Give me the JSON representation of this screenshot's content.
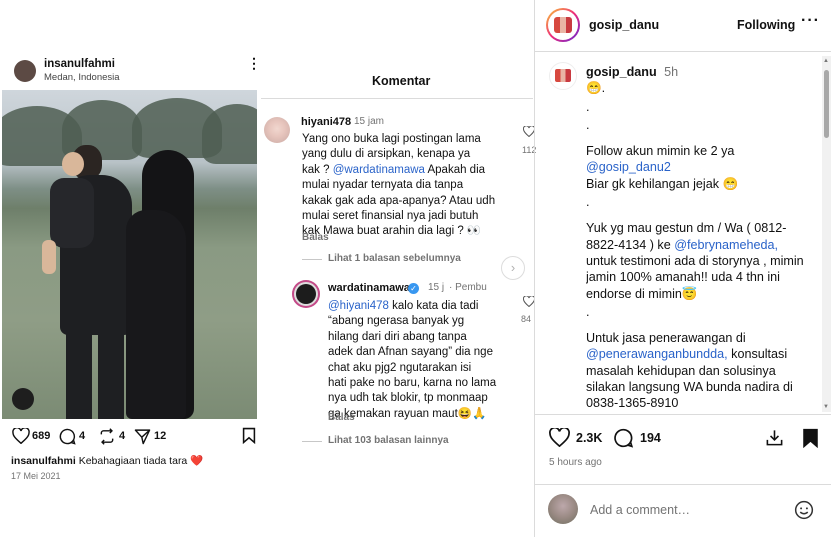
{
  "post": {
    "username": "insanulfahmi",
    "location": "Medan, Indonesia",
    "likes": "689",
    "comments": "4",
    "reposts": "4",
    "shares": "12",
    "caption_user": "insanulfahmi",
    "caption_text": "Kebahagiaan tiada tara ❤️",
    "date": "17 Mei 2021"
  },
  "comments_panel": {
    "title": "Komentar",
    "c1": {
      "user": "hiyani478",
      "time": "15 jam",
      "lines": [
        "Yang ono buka lagi postingan lama",
        "yang dulu di arsipkan, kenapa ya",
        "kak ?",
        "mulai nyadar ternyata dia tanpa",
        "kakak gak ada apa-apanya? Atau udh",
        "mulai seret finansial nya jadi butuh",
        "kak Mawa buat arahin dia lagi ? 👀"
      ],
      "mention": "@wardatinamawa",
      "line3_rest": "Apakah dia",
      "reply_label": "Balas",
      "like_count": "112",
      "view_prev": "Lihat 1 balasan sebelumnya"
    },
    "c2": {
      "user": "wardatinamawa",
      "time": "15 j",
      "badge": "Pembu",
      "mention": "@hiyani478",
      "line1_rest": "kalo kata dia tadi",
      "lines": [
        "“abang ngerasa banyak yg",
        "hilang dari diri abang tanpa",
        "adek dan Afnan sayang” dia nge",
        "chat aku pjg2 ngutarakan isi",
        "hati pake no baru, karna no lama",
        "nya udh tak blokir, tp monmaap",
        "ga kemakan rayuan maut😆🙏"
      ],
      "reply_label": "Balas",
      "like_count": "84"
    },
    "view_more": "Lihat 103 balasan lainnya"
  },
  "right": {
    "username": "gosip_danu",
    "follow_label": "Following",
    "caption_user": "gosip_danu",
    "caption_time": "5h",
    "caption_emoji": "😁.",
    "dot1": ".",
    "dot2": ".",
    "follow_line": "Follow akun mimin ke 2 ya",
    "mention1": "@gosip_danu2",
    "biar": "Biar gk kehilangan jejak 😁",
    "dot3": ".",
    "yuk1": "Yuk yg mau gestun dm / Wa ( 0812-",
    "yuk2_pre": "8822-4134 ) ke",
    "mention2": "@febrynameheda,",
    "yuk3": "untuk testimoni ada di storynya , mimin",
    "yuk4": "jamin 100% amanah!! uda 4 thn ini",
    "yuk5": "endorse di mimin😇",
    "dot4": ".",
    "jasa1": "Untuk jasa penerawangan di",
    "mention3": "@penerawanganbundda,",
    "jasa2_rest": "konsultasi",
    "jasa3": "masalah kehidupan dan solusinya",
    "jasa4": "silakan langsung WA bunda nadira di",
    "jasa5": "0838-1365-8910",
    "likes": "2.3K",
    "comments": "194",
    "time_ago": "5 hours ago",
    "add_comment_placeholder": "Add a comment…"
  },
  "colors": {
    "link": "#2a63c9",
    "secondary": "#737373",
    "divider": "#dbdbdb",
    "verified": "#3897f0"
  }
}
